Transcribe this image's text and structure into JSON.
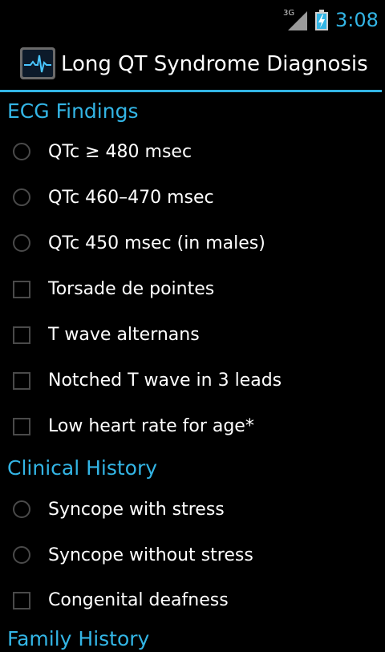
{
  "status_bar": {
    "network_type": "3G",
    "time": "3:08",
    "accent_color": "#33b5e5"
  },
  "action_bar": {
    "title": "Long QT Syndrome Diagnosis",
    "icon": "ecg-waveform-icon"
  },
  "sections": [
    {
      "header": "ECG Findings",
      "items": [
        {
          "label": "QTc ≥ 480 msec",
          "control": "radio",
          "checked": false
        },
        {
          "label": "QTc 460–470 msec",
          "control": "radio",
          "checked": false
        },
        {
          "label": "QTc 450 msec (in males)",
          "control": "radio",
          "checked": false
        },
        {
          "label": "Torsade de pointes",
          "control": "checkbox",
          "checked": false
        },
        {
          "label": "T wave alternans",
          "control": "checkbox",
          "checked": false
        },
        {
          "label": "Notched T wave in 3 leads",
          "control": "checkbox",
          "checked": false
        },
        {
          "label": "Low heart rate for age*",
          "control": "checkbox",
          "checked": false
        }
      ]
    },
    {
      "header": "Clinical History",
      "items": [
        {
          "label": "Syncope with stress",
          "control": "radio",
          "checked": false
        },
        {
          "label": "Syncope without stress",
          "control": "radio",
          "checked": false
        },
        {
          "label": "Congenital deafness",
          "control": "checkbox",
          "checked": false
        }
      ]
    },
    {
      "header": "Family History"
    }
  ]
}
